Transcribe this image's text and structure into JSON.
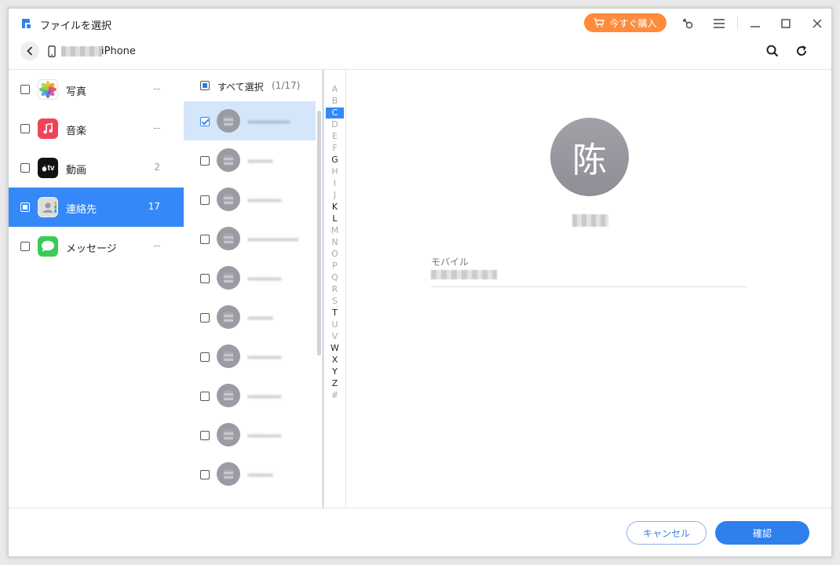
{
  "window": {
    "title": "ファイルを選択",
    "buy_label": "今すぐ購入",
    "device_name": "iPhone"
  },
  "sidebar": {
    "items": [
      {
        "label": "写真",
        "count": "--",
        "icon": "photos-icon"
      },
      {
        "label": "音楽",
        "count": "--",
        "icon": "music-icon"
      },
      {
        "label": "動画",
        "count": "2",
        "icon": "tv-icon",
        "icon_text": "tv"
      },
      {
        "label": "連絡先",
        "count": "17",
        "icon": "contacts-icon",
        "active": true
      },
      {
        "label": "メッセージ",
        "count": "--",
        "icon": "messages-icon"
      }
    ]
  },
  "contacts": {
    "select_all_label": "すべて選択",
    "select_all_count": "(1/17)",
    "rows": [
      {
        "name": "ꟷꟷꟷꟷꟷ",
        "selected": true
      },
      {
        "name": "ꟷꟷꟷ"
      },
      {
        "name": "ꟷꟷꟷꟷ"
      },
      {
        "name": "ꟷꟷꟷꟷꟷꟷ"
      },
      {
        "name": "ꟷꟷꟷꟷ"
      },
      {
        "name": "ꟷꟷꟷ"
      },
      {
        "name": "ꟷꟷꟷꟷ"
      },
      {
        "name": "ꟷꟷꟷꟷ"
      },
      {
        "name": "ꟷꟷꟷꟷ"
      },
      {
        "name": "ꟷꟷꟷ"
      }
    ]
  },
  "alphabet": {
    "letters": [
      "A",
      "B",
      "C",
      "D",
      "E",
      "F",
      "G",
      "H",
      "I",
      "J",
      "K",
      "L",
      "M",
      "N",
      "O",
      "P",
      "Q",
      "R",
      "S",
      "T",
      "U",
      "V",
      "W",
      "X",
      "Y",
      "Z",
      "#"
    ],
    "has": [
      "C",
      "G",
      "K",
      "L",
      "T",
      "W",
      "X",
      "Y",
      "Z"
    ],
    "active": "C"
  },
  "detail": {
    "avatar_char": "陈",
    "field_label": "モバイル"
  },
  "footer": {
    "cancel_label": "キャンセル",
    "confirm_label": "確認"
  },
  "colors": {
    "accent": "#3488f7",
    "buy": "#ff8b3d"
  }
}
